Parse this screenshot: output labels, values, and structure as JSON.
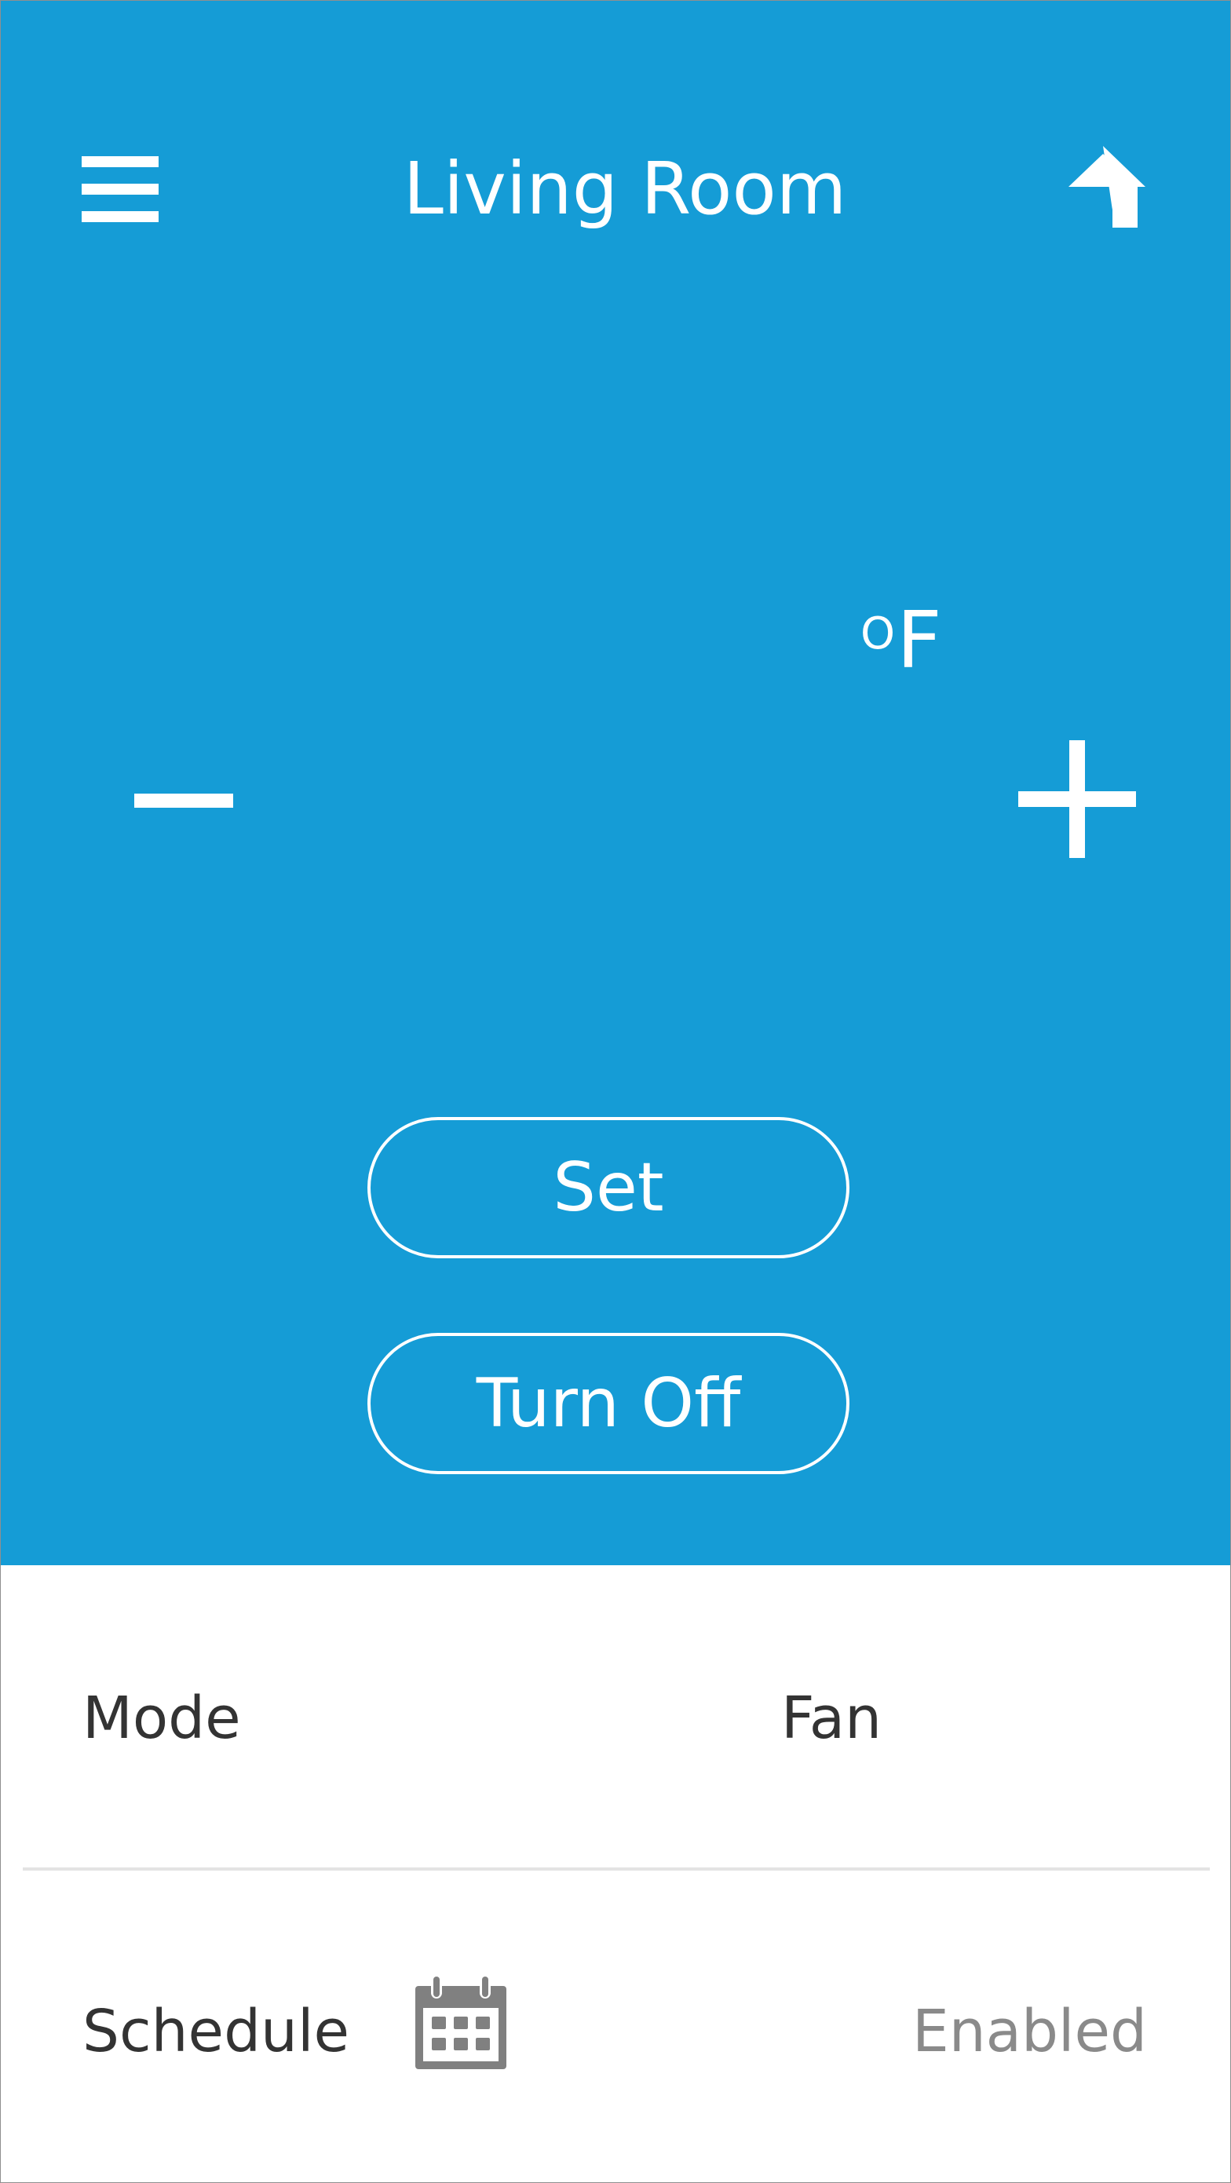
{
  "header": {
    "title": "Living Room",
    "menu_icon": "hamburger-menu-icon",
    "home_icon": "home-icon"
  },
  "thermostat": {
    "unit_degree_symbol": "O",
    "unit_letter": "F",
    "decrease_icon": "minus-icon",
    "increase_icon": "plus-icon"
  },
  "actions": {
    "set_label": "Set",
    "turn_off_label": "Turn Off"
  },
  "settings": {
    "mode": {
      "label": "Mode",
      "value": "Fan"
    },
    "schedule": {
      "label": "Schedule",
      "icon": "calendar-icon",
      "value": "Enabled"
    }
  },
  "colors": {
    "accent": "#159cd6",
    "panel_text": "#ffffff",
    "row_text": "#333333",
    "muted_text": "#8a8a8a",
    "icon_gray": "#808080",
    "divider": "#e3e3e3"
  }
}
